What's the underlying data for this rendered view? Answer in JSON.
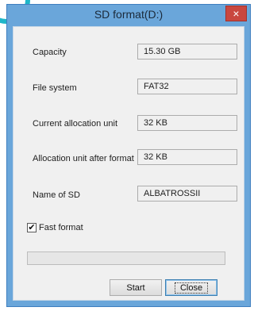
{
  "window": {
    "title": "SD format(D:)",
    "close_glyph": "×"
  },
  "rows": [
    {
      "label": "Capacity",
      "value": "15.30 GB"
    },
    {
      "label": "File system",
      "value": "FAT32"
    },
    {
      "label": "Current allocation unit",
      "value": "32 KB"
    },
    {
      "label": "Allocation unit after format",
      "value": "32 KB"
    },
    {
      "label": "Name of SD",
      "value": "ALBATROSSII"
    }
  ],
  "options": {
    "fast_format_label": "Fast format",
    "fast_format_checked": true,
    "check_glyph": "✔"
  },
  "progress": {
    "fraction": 0.0
  },
  "buttons": {
    "start": "Start",
    "close": "Close"
  },
  "colors": {
    "title_bar": "#6aa6da",
    "close_button": "#c9473f",
    "client_bg": "#f0f0f0",
    "accent_arc": "#1fb6c8"
  }
}
